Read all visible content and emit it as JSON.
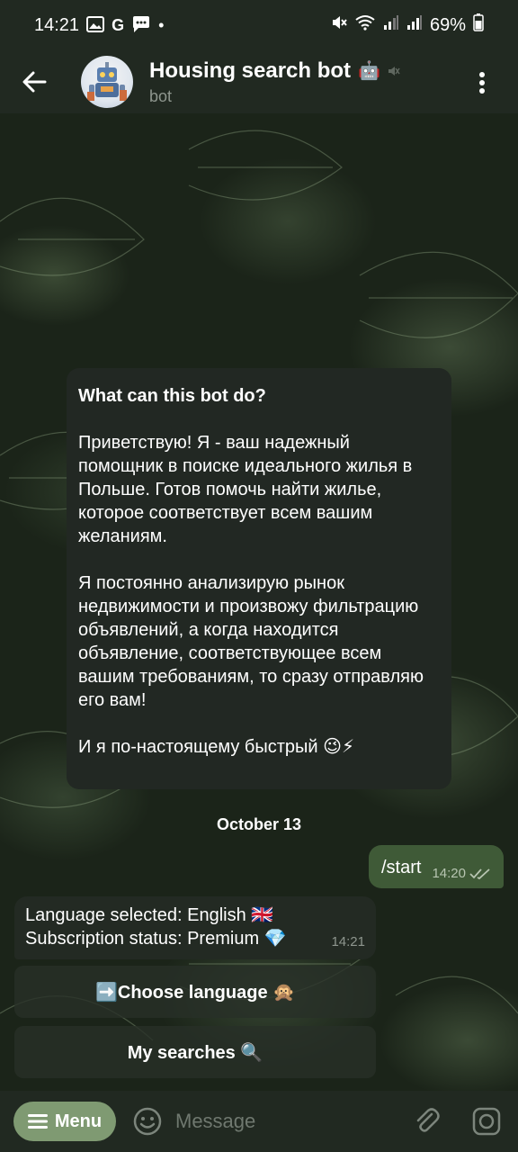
{
  "status_bar": {
    "time": "14:21",
    "battery": "69%"
  },
  "header": {
    "title": "Housing search bot",
    "title_emoji": "🤖",
    "subtitle": "bot"
  },
  "info_card": {
    "title": "What can this bot do?",
    "paragraph1": "Приветствую! Я - ваш надежный помощник в поиске идеального жилья в Польше. Готов помочь найти жилье, которое соответствует всем вашим желаниям.",
    "paragraph2": "Я постоянно анализирую рынок недвижимости и произвожу фильтрацию объявлений, а когда находится объявление, соответствующее всем вашим требованиям, то сразу отправляю его вам!",
    "paragraph3": "И я по-настоящему быстрый 😉⚡"
  },
  "date_separator": "October 13",
  "outgoing_message": {
    "text": "/start",
    "time": "14:20"
  },
  "incoming_message": {
    "line1": "Language selected: English 🇬🇧",
    "line2": "Subscription status: Premium 💎",
    "time": "14:21"
  },
  "keyboard_buttons": {
    "choose_language": "➡️Choose language 🙊",
    "my_searches": "My searches 🔍"
  },
  "bottom_bar": {
    "menu_label": "Menu",
    "message_placeholder": "Message"
  },
  "colors": {
    "header_bg": "#212921",
    "menu_button": "#7f9a72",
    "outgoing_bubble": "#3f5a37",
    "incoming_bubble": "#232a23"
  }
}
